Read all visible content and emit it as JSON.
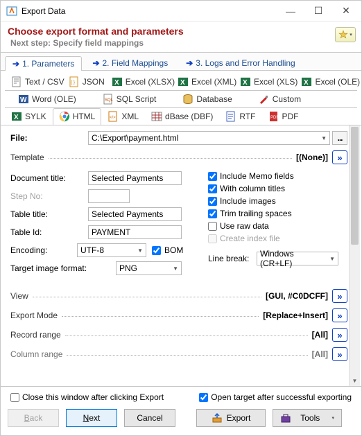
{
  "window": {
    "title": "Export Data"
  },
  "header": {
    "title": "Choose export format and parameters",
    "next_step": "Next step: Specify field mappings"
  },
  "wizard_tabs": [
    {
      "label": "1. Parameters",
      "active": true
    },
    {
      "label": "2. Field Mappings",
      "active": false
    },
    {
      "label": "3. Logs and Error Handling",
      "active": false
    }
  ],
  "formats_row1": [
    {
      "label": "Text / CSV",
      "icon": "text-icon"
    },
    {
      "label": "JSON",
      "icon": "json-icon"
    },
    {
      "label": "Excel (XLSX)",
      "icon": "excel-icon"
    },
    {
      "label": "Excel (XML)",
      "icon": "excel-icon"
    },
    {
      "label": "Excel (XLS)",
      "icon": "excel-icon"
    },
    {
      "label": "Excel (OLE)",
      "icon": "excel-icon"
    }
  ],
  "formats_row2": [
    {
      "label": "Word (OLE)",
      "icon": "word-icon"
    },
    {
      "label": "SQL Script",
      "icon": "sql-icon"
    },
    {
      "label": "Database",
      "icon": "db-icon"
    },
    {
      "label": "Custom",
      "icon": "custom-icon"
    }
  ],
  "formats_row3": [
    {
      "label": "SYLK",
      "icon": "sylk-icon"
    },
    {
      "label": "HTML",
      "icon": "chrome-icon",
      "active": true
    },
    {
      "label": "XML",
      "icon": "xml-icon"
    },
    {
      "label": "dBase (DBF)",
      "icon": "dbf-icon"
    },
    {
      "label": "RTF",
      "icon": "rtf-icon"
    },
    {
      "label": "PDF",
      "icon": "pdf-icon"
    }
  ],
  "form": {
    "file_label": "File:",
    "file_value": "C:\\Export\\payment.html",
    "template_label": "Template",
    "template_value": "[(None)]",
    "doc_title_label": "Document title:",
    "doc_title_value": "Selected Payments",
    "step_no_label": "Step No:",
    "step_no_value": "",
    "table_title_label": "Table title:",
    "table_title_value": "Selected Payments",
    "table_id_label": "Table Id:",
    "table_id_value": "PAYMENT",
    "encoding_label": "Encoding:",
    "encoding_value": "UTF-8",
    "bom_label": "BOM",
    "target_img_label": "Target image format:",
    "target_img_value": "PNG",
    "checks": {
      "memo": "Include Memo fields",
      "column_titles": "With column titles",
      "images": "Include images",
      "trim": "Trim trailing spaces",
      "raw": "Use raw data",
      "index": "Create index file"
    },
    "line_break_label": "Line break:",
    "line_break_value": "Windows (CR+LF)",
    "view_label": "View",
    "view_value": "[GUI, #C0DCFF]",
    "export_mode_label": "Export Mode",
    "export_mode_value": "[Replace+Insert]",
    "record_range_label": "Record range",
    "record_range_value": "[All]",
    "column_range_label": "Column range",
    "column_range_value": "[All]"
  },
  "bottom_checks": {
    "close_after": "Close this window after clicking Export",
    "open_target": "Open target after successful exporting"
  },
  "buttons": {
    "back": "Back",
    "next": "Next",
    "cancel": "Cancel",
    "export": "Export",
    "tools": "Tools"
  }
}
